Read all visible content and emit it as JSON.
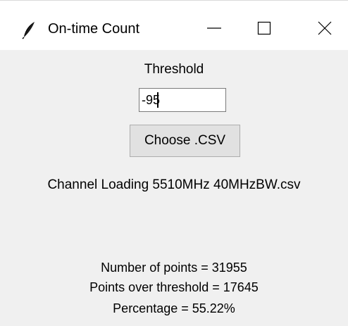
{
  "window": {
    "title": "On-time Count",
    "icons": {
      "app": "feather-icon",
      "minimize": "minimize-icon",
      "maximize": "maximize-icon",
      "close": "close-icon"
    }
  },
  "form": {
    "threshold_label": "Threshold",
    "threshold_value": "-95",
    "choose_button_label": "Choose .CSV",
    "file_name": "Channel Loading 5510MHz 40MHzBW.csv"
  },
  "results": {
    "points_line": "Number of points = 31955",
    "over_threshold_line": "Points over threshold = 17645",
    "percentage_line": "Percentage = 55.22%"
  }
}
